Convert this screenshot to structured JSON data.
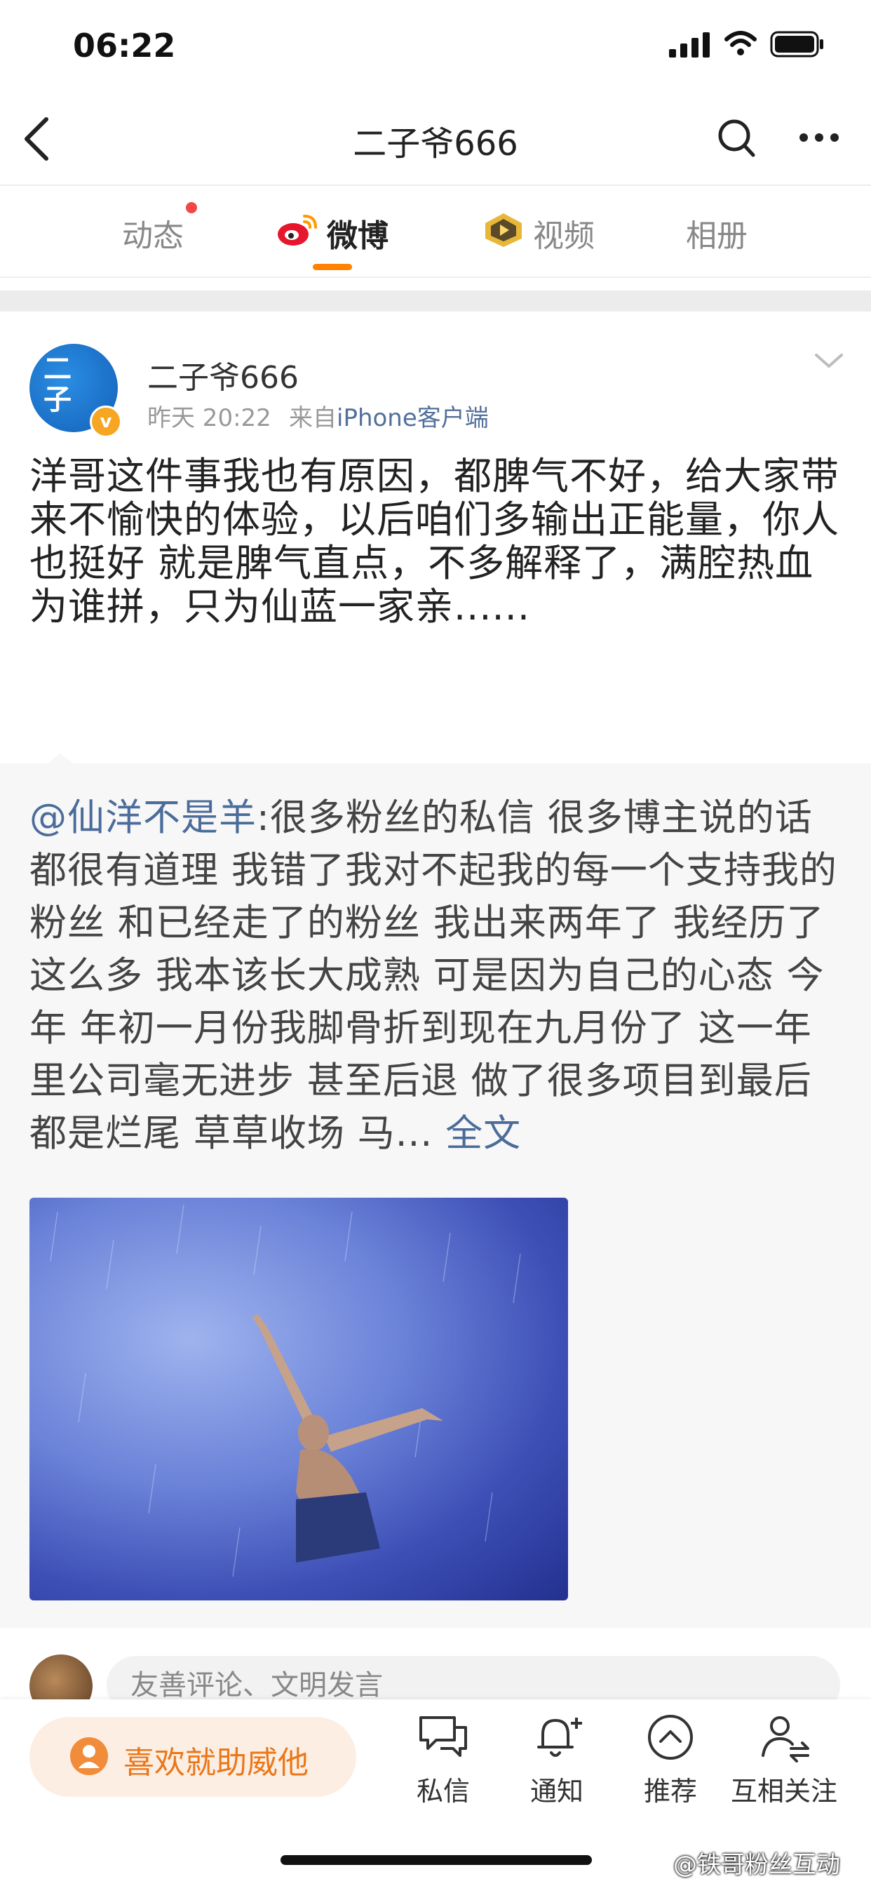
{
  "status_bar": {
    "time": "06:22"
  },
  "nav": {
    "title": "二子爷666"
  },
  "tabs": [
    {
      "label": "动态"
    },
    {
      "label": "微博"
    },
    {
      "label": "视频"
    },
    {
      "label": "相册"
    }
  ],
  "post": {
    "author": "二子爷666",
    "time": "昨天 20:22",
    "source_prefix": "来自",
    "source_device": "iPhone客户端",
    "text": "洋哥这件事我也有原因，都脾气不好，给大家带来不愉快的体验，以后咱们多输出正能量，你人也挺好 就是脾气直点，不多解释了，满腔热血为谁拼，只为仙蓝一家亲......",
    "repost": {
      "mention": "@仙洋不是羊",
      "text": ":很多粉丝的私信 很多博主说的话都很有道理 我错了我对不起我的每一个支持我的粉丝 和已经走了的粉丝 我出来两年了 我经历了这么多 我本该长大成熟 可是因为自己的心态 今年 年初一月份我脚骨折到现在九月份了 这一年里公司毫无进步 甚至后退 做了很多项目到最后都是烂尾 草草收场 马...",
      "full_text_link": "全文"
    }
  },
  "comment": {
    "placeholder": "友善评论、文明发言"
  },
  "bottom_bar": {
    "like_button": "喜欢就助威他",
    "items": [
      {
        "label": "私信",
        "icon": "message-icon"
      },
      {
        "label": "通知",
        "icon": "bell-plus-icon"
      },
      {
        "label": "推荐",
        "icon": "chevron-up-circle-icon"
      },
      {
        "label": "互相关注",
        "icon": "user-follow-icon"
      }
    ]
  },
  "watermark": "@铁哥粉丝互动",
  "colors": {
    "accent": "#ff8200",
    "link": "#4b6c9b",
    "badge": "#f6a623"
  }
}
